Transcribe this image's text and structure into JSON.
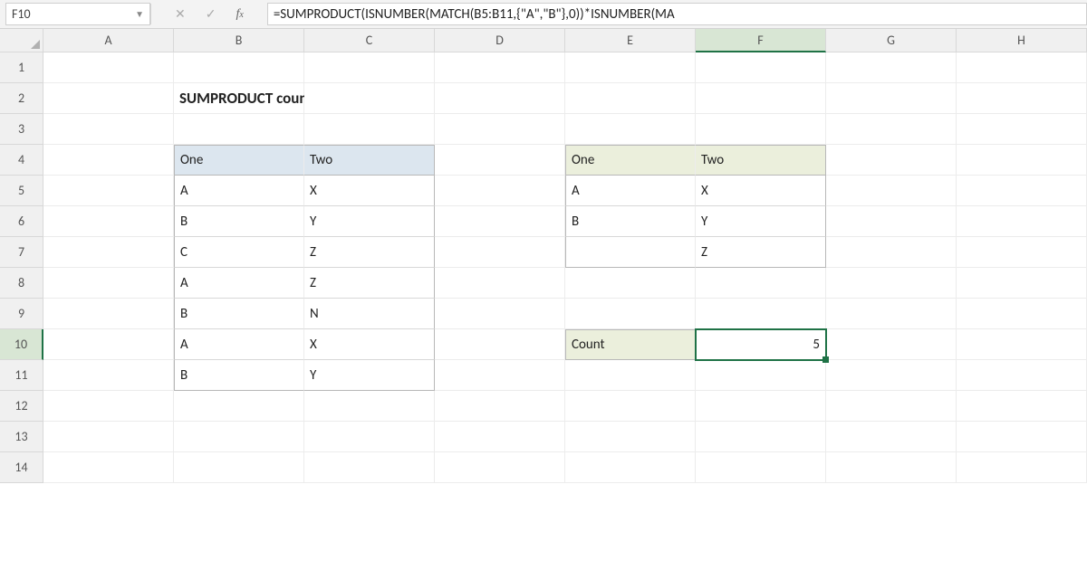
{
  "namebox": {
    "value": "F10"
  },
  "formula_bar": {
    "text": "=SUMPRODUCT(ISNUMBER(MATCH(B5:B11,{\"A\",\"B\"},0))*ISNUMBER(MA"
  },
  "columns": [
    "A",
    "B",
    "C",
    "D",
    "E",
    "F",
    "G",
    "H",
    ""
  ],
  "active_col_index": 5,
  "rows": [
    1,
    2,
    3,
    4,
    5,
    6,
    7,
    8,
    9,
    10,
    11,
    12,
    13,
    14
  ],
  "active_row_index": 9,
  "title": "SUMPRODUCT count multiple OR criteria",
  "table1": {
    "headers": [
      "One",
      "Two"
    ],
    "rows": [
      [
        "A",
        "X"
      ],
      [
        "B",
        "Y"
      ],
      [
        "C",
        "Z"
      ],
      [
        "A",
        "Z"
      ],
      [
        "B",
        "N"
      ],
      [
        "A",
        "X"
      ],
      [
        "B",
        "Y"
      ]
    ]
  },
  "table2": {
    "headers": [
      "One",
      "Two"
    ],
    "rows": [
      [
        "A",
        "X"
      ],
      [
        "B",
        "Y"
      ],
      [
        "",
        "Z"
      ]
    ]
  },
  "count_label": "Count",
  "count_value": "5",
  "active_cell": {
    "col": 6,
    "row": 10
  }
}
